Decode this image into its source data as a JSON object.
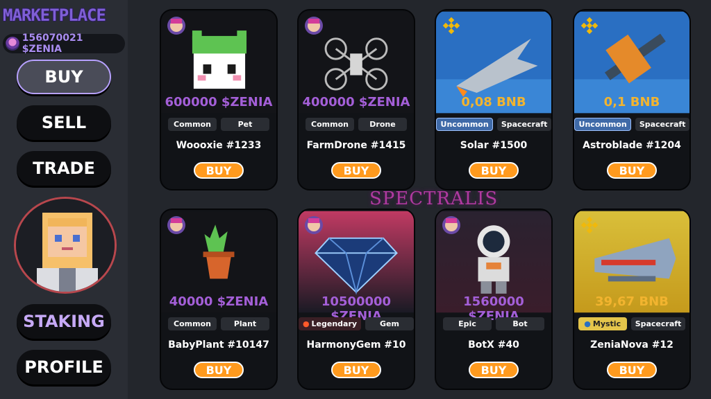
{
  "sidebar": {
    "brand": "MARKETPLACE",
    "balance": "156070021 $ZENIA",
    "nav": {
      "buy": "BUY",
      "sell": "SELL",
      "trade": "TRADE",
      "staking": "STAKING",
      "profile": "PROFILE"
    },
    "colors": {
      "active_border": "#b7a1ff",
      "staking_text": "#c6a9f5",
      "avatar_ring": "#b8474d"
    }
  },
  "watermark": "SPECTRALIS",
  "cards": [
    {
      "price": "600000 $ZENIA",
      "rarity": "Common",
      "category": "Pet",
      "name": "Woooxie #1233",
      "buy": "BUY",
      "badge": "zenia-avatar-icon",
      "price_color": "#a45fd8"
    },
    {
      "price": "400000 $ZENIA",
      "rarity": "Common",
      "category": "Drone",
      "name": "FarmDrone #1415",
      "buy": "BUY",
      "badge": "zenia-avatar-icon",
      "price_color": "#a45fd8"
    },
    {
      "price": "0,08 BNB",
      "rarity": "Uncommon",
      "category": "Spacecraft",
      "name": "Solar #1500",
      "buy": "BUY",
      "badge": "bnb-icon",
      "price_color": "#f2b42f"
    },
    {
      "price": "0,1 BNB",
      "rarity": "Uncommon",
      "category": "Spacecraft",
      "name": "Astroblade #1204",
      "buy": "BUY",
      "badge": "bnb-icon",
      "price_color": "#f2b42f"
    },
    {
      "price": "40000 $ZENIA",
      "rarity": "Common",
      "category": "Plant",
      "name": "BabyPlant #10147",
      "buy": "BUY",
      "badge": "zenia-avatar-icon",
      "price_color": "#a45fd8"
    },
    {
      "price": "10500000 $ZENIA",
      "rarity": "Legendary",
      "category": "Gem",
      "name": "HarmonyGem #10",
      "buy": "BUY",
      "badge": "zenia-avatar-icon",
      "price_color": "#a45fd8"
    },
    {
      "price": "1560000 $ZENIA",
      "rarity": "Epic",
      "category": "Bot",
      "name": "BotX #40",
      "buy": "BUY",
      "badge": "zenia-avatar-icon",
      "price_color": "#a45fd8"
    },
    {
      "price": "39,67 BNB",
      "rarity": "Mystic",
      "category": "Spacecraft",
      "name": "ZeniaNova #12",
      "buy": "BUY",
      "badge": "bnb-icon",
      "price_color": "#f2b42f"
    }
  ]
}
